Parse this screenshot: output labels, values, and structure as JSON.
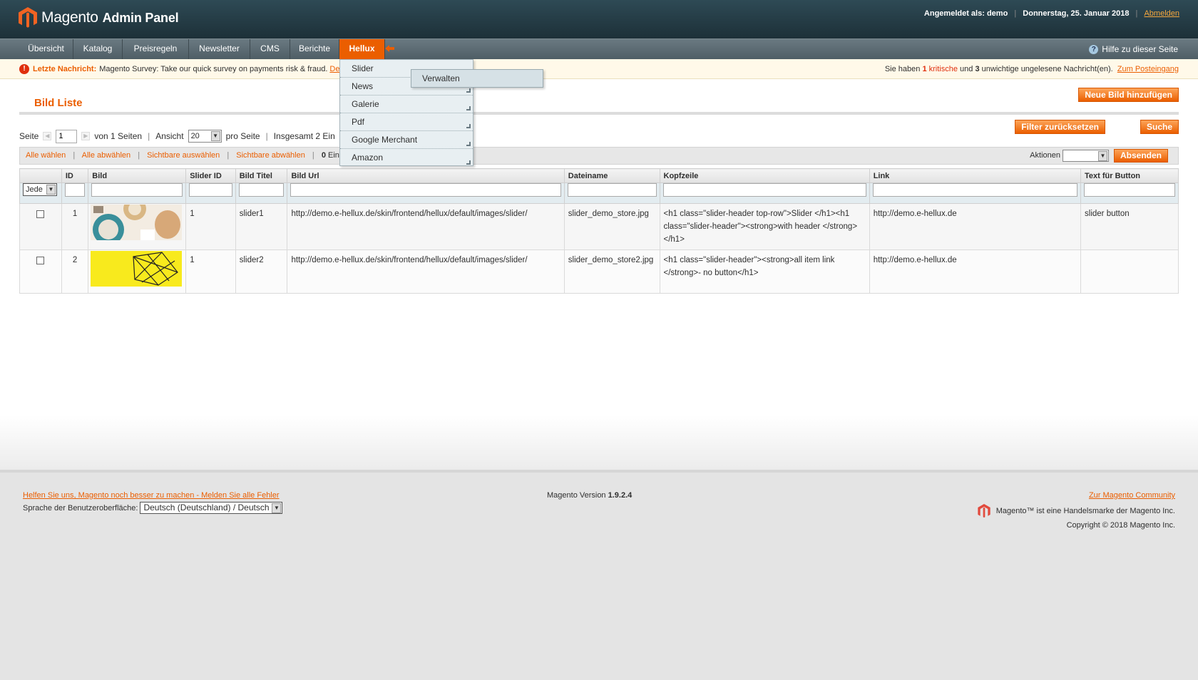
{
  "header": {
    "brand": "Magento",
    "subtitle": "Admin Panel",
    "logged_in_label": "Angemeldet als:",
    "user": "demo",
    "date": "Donnerstag, 25. Januar 2018",
    "logout": "Abmelden"
  },
  "nav": {
    "items": [
      "Übersicht",
      "Katalog",
      "Preisregeln",
      "Newsletter",
      "CMS",
      "Berichte",
      "Hellux"
    ],
    "help": "Hilfe zu dieser Seite"
  },
  "dropdown": {
    "items": [
      "Slider",
      "News",
      "Galerie",
      "Pdf",
      "Google Merchant",
      "Amazon"
    ],
    "submenu": "Verwalten"
  },
  "messages": {
    "label": "Letzte Nachricht:",
    "text": "Magento Survey: Take our quick survey on payments risk & fraud.",
    "link": "De",
    "right_prefix": "Sie haben",
    "critical_count": "1",
    "critical_label": "kritische",
    "mid": "und",
    "important_count": "3",
    "suffix": "unwichtige ungelesene Nachricht(en).",
    "inbox_link": "Zum Posteingang"
  },
  "page": {
    "title": "Bild Liste",
    "add_button": "Neue Bild hinzufügen",
    "reset_filter": "Filter zurücksetzen",
    "search": "Suche"
  },
  "pager": {
    "page_label": "Seite",
    "page_value": "1",
    "of_pages": "von 1 Seiten",
    "view_label": "Ansicht",
    "per_page_value": "20",
    "per_page_label": "pro Seite",
    "total": "Insgesamt 2 Ein"
  },
  "massaction": {
    "select_all": "Alle wählen",
    "unselect_all": "Alle abwählen",
    "select_visible": "Sichtbare auswählen",
    "unselect_visible": "Sichtbare abwählen",
    "selected_count": "0",
    "selected_label": "Einträg",
    "actions_label": "Aktionen",
    "submit": "Absenden"
  },
  "grid": {
    "columns": [
      "",
      "ID",
      "Bild",
      "Slider ID",
      "Bild Titel",
      "Bild Url",
      "Dateiname",
      "Kopfzeile",
      "Link",
      "Text für Button"
    ],
    "filter_select": "Jede",
    "rows": [
      {
        "id": "1",
        "slider_id": "1",
        "title": "slider1",
        "url": "http://demo.e-hellux.de/skin/frontend/hellux/default/images/slider/",
        "filename": "slider_demo_store.jpg",
        "header": "<h1 class=\"slider-header top-row\">Slider </h1><h1 class=\"slider-header\"><strong>with header </strong></h1>",
        "link": "http://demo.e-hellux.de",
        "button_text": "slider button"
      },
      {
        "id": "2",
        "slider_id": "1",
        "title": "slider2",
        "url": "http://demo.e-hellux.de/skin/frontend/hellux/default/images/slider/",
        "filename": "slider_demo_store2.jpg",
        "header": "<h1 class=\"slider-header\"><strong>all item link </strong>- no button</h1>",
        "link": "http://demo.e-hellux.de",
        "button_text": ""
      }
    ]
  },
  "footer": {
    "help_link": "Helfen Sie uns, Magento noch besser zu machen - Melden Sie alle Fehler",
    "locale_label": "Sprache der Benutzeroberfläche:",
    "locale_value": "Deutsch (Deutschland) / Deutsch",
    "version_label": "Magento Version",
    "version": "1.9.2.4",
    "community_link": "Zur Magento Community",
    "trademark": "Magento™ ist eine Handelsmarke der Magento Inc.",
    "copyright": "Copyright © 2018 Magento Inc."
  },
  "colors": {
    "accent": "#eb5e00",
    "header_bg": "#263d46",
    "nav_bg": "#5b6a71",
    "message_bg": "#fff9e9"
  },
  "icons": [
    "magento-logo-icon",
    "pin-icon",
    "help-icon",
    "alert-icon",
    "chevron-down-icon",
    "prev-page-icon",
    "next-page-icon"
  ]
}
